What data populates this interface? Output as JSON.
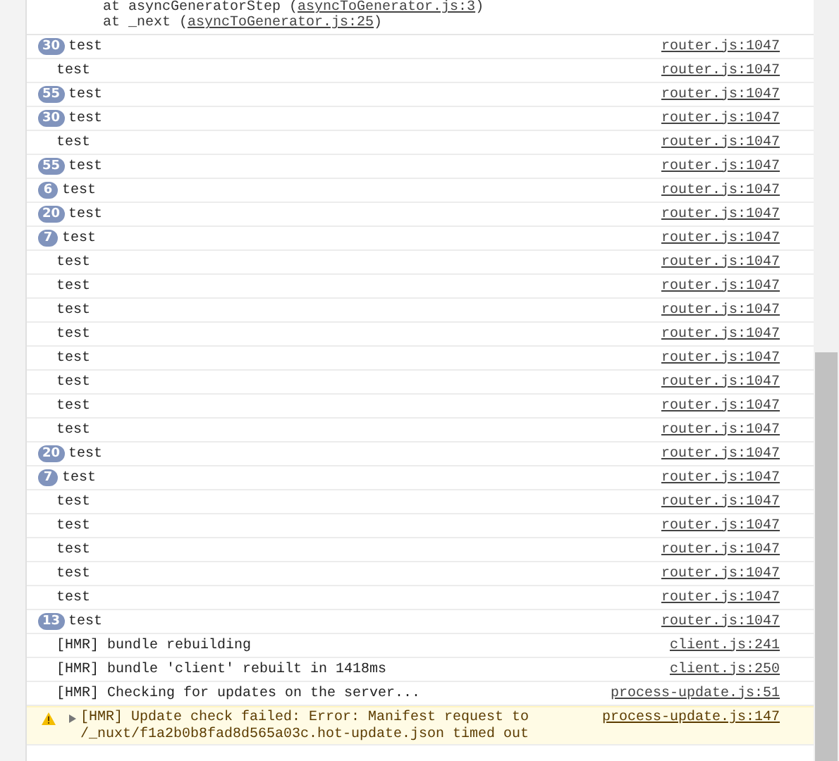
{
  "trace": [
    {
      "prefix": "at asyncGeneratorStep (",
      "link": "asyncToGenerator.js:3",
      "suffix": ")"
    },
    {
      "prefix": "at _next (",
      "link": "asyncToGenerator.js:25",
      "suffix": ")"
    }
  ],
  "messages": [
    {
      "kind": "log",
      "count": "30",
      "text": "test",
      "source": "router.js:1047"
    },
    {
      "kind": "log",
      "text": "test",
      "source": "router.js:1047"
    },
    {
      "kind": "log",
      "count": "55",
      "text": "test",
      "source": "router.js:1047"
    },
    {
      "kind": "log",
      "count": "30",
      "text": "test",
      "source": "router.js:1047"
    },
    {
      "kind": "log",
      "text": "test",
      "source": "router.js:1047"
    },
    {
      "kind": "log",
      "count": "55",
      "text": "test",
      "source": "router.js:1047"
    },
    {
      "kind": "log",
      "count": "6",
      "text": "test",
      "source": "router.js:1047"
    },
    {
      "kind": "log",
      "count": "20",
      "text": "test",
      "source": "router.js:1047"
    },
    {
      "kind": "log",
      "count": "7",
      "text": "test",
      "source": "router.js:1047"
    },
    {
      "kind": "log",
      "text": "test",
      "source": "router.js:1047"
    },
    {
      "kind": "log",
      "text": "test",
      "source": "router.js:1047"
    },
    {
      "kind": "log",
      "text": "test",
      "source": "router.js:1047"
    },
    {
      "kind": "log",
      "text": "test",
      "source": "router.js:1047"
    },
    {
      "kind": "log",
      "text": "test",
      "source": "router.js:1047"
    },
    {
      "kind": "log",
      "text": "test",
      "source": "router.js:1047"
    },
    {
      "kind": "log",
      "text": "test",
      "source": "router.js:1047"
    },
    {
      "kind": "log",
      "text": "test",
      "source": "router.js:1047"
    },
    {
      "kind": "log",
      "count": "20",
      "text": "test",
      "source": "router.js:1047"
    },
    {
      "kind": "log",
      "count": "7",
      "text": "test",
      "source": "router.js:1047"
    },
    {
      "kind": "log",
      "text": "test",
      "source": "router.js:1047"
    },
    {
      "kind": "log",
      "text": "test",
      "source": "router.js:1047"
    },
    {
      "kind": "log",
      "text": "test",
      "source": "router.js:1047"
    },
    {
      "kind": "log",
      "text": "test",
      "source": "router.js:1047"
    },
    {
      "kind": "log",
      "text": "test",
      "source": "router.js:1047"
    },
    {
      "kind": "log",
      "count": "13",
      "text": "test",
      "source": "router.js:1047"
    },
    {
      "kind": "log",
      "text": "[HMR] bundle rebuilding",
      "source": "client.js:241"
    },
    {
      "kind": "log",
      "text": "[HMR] bundle 'client' rebuilt in 1418ms",
      "source": "client.js:250"
    },
    {
      "kind": "log",
      "text": "[HMR] Checking for updates on the server...",
      "source": "process-update.js:51"
    },
    {
      "kind": "warning",
      "expanded": false,
      "text": "[HMR] Update check failed: Error: Manifest request to",
      "text_2": "/_nuxt/f1a2b0b8fad8d565a03c.hot-update.json timed out",
      "source": "process-update.js:147"
    }
  ]
}
